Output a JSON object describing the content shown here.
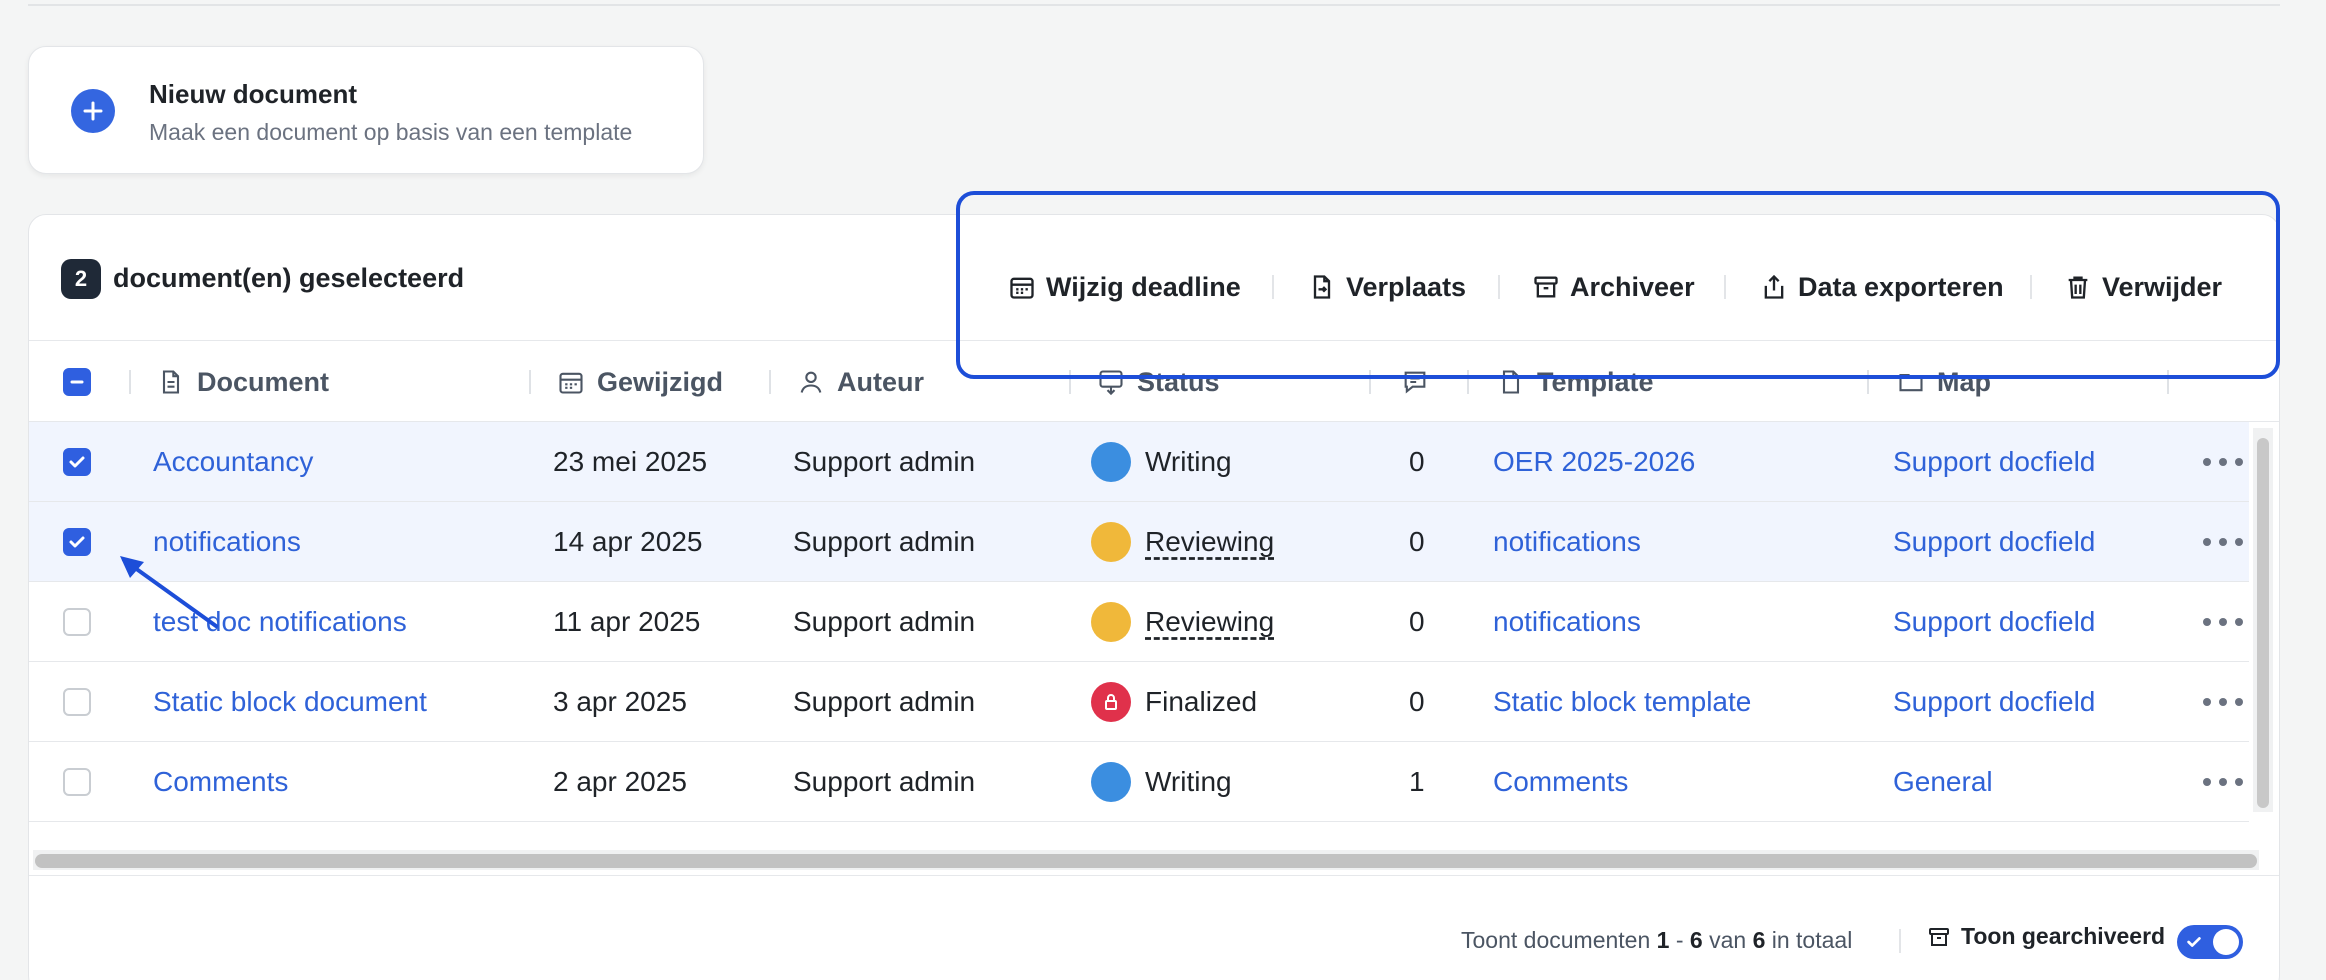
{
  "new_document": {
    "title": "Nieuw document",
    "subtitle": "Maak een document op basis van een template"
  },
  "selection": {
    "count": "2",
    "label": "document(en) geselecteerd"
  },
  "actions": [
    {
      "label": "Wijzig deadline",
      "icon": "calendar-icon"
    },
    {
      "label": "Verplaats",
      "icon": "file-move-icon"
    },
    {
      "label": "Archiveer",
      "icon": "archive-icon"
    },
    {
      "label": "Data exporteren",
      "icon": "export-icon"
    },
    {
      "label": "Verwijder",
      "icon": "trash-icon"
    }
  ],
  "columns": {
    "document": "Document",
    "modified": "Gewijzigd",
    "author": "Auteur",
    "status": "Status",
    "template": "Template",
    "folder": "Map"
  },
  "rows": [
    {
      "checked": true,
      "document": "Accountancy",
      "modified": "23 mei 2025",
      "author": "Support admin",
      "status": "Writing",
      "status_color": "#3b8ee0",
      "comments": "0",
      "template": "OER 2025-2026",
      "folder": "Support docfield"
    },
    {
      "checked": true,
      "document": "notifications",
      "modified": "14 apr 2025",
      "author": "Support admin",
      "status": "Reviewing",
      "status_color": "#f0b83a",
      "comments": "0",
      "template": "notifications",
      "folder": "Support docfield"
    },
    {
      "checked": false,
      "document": "test doc notifications",
      "modified": "11 apr 2025",
      "author": "Support admin",
      "status": "Reviewing",
      "status_color": "#f0b83a",
      "comments": "0",
      "template": "notifications",
      "folder": "Support docfield"
    },
    {
      "checked": false,
      "document": "Static block document",
      "modified": "3 apr 2025",
      "author": "Support admin",
      "status": "Finalized",
      "status_color": "#e0314b",
      "comments": "0",
      "template": "Static block template",
      "folder": "Support docfield"
    },
    {
      "checked": false,
      "document": "Comments",
      "modified": "2 apr 2025",
      "author": "Support admin",
      "status": "Writing",
      "status_color": "#3b8ee0",
      "comments": "1",
      "template": "Comments",
      "folder": "General"
    }
  ],
  "footer": {
    "prefix": "Toont documenten",
    "from": "1",
    "dash": "-",
    "to": "6",
    "of": "van",
    "total": "6",
    "suffix": "in totaal",
    "archived_toggle_label": "Toon gearchiveerd",
    "archived_toggle_on": true
  },
  "colors": {
    "accent": "#2f5fe0",
    "link": "#2f62d8",
    "highlight_border": "#1d4ed8"
  }
}
